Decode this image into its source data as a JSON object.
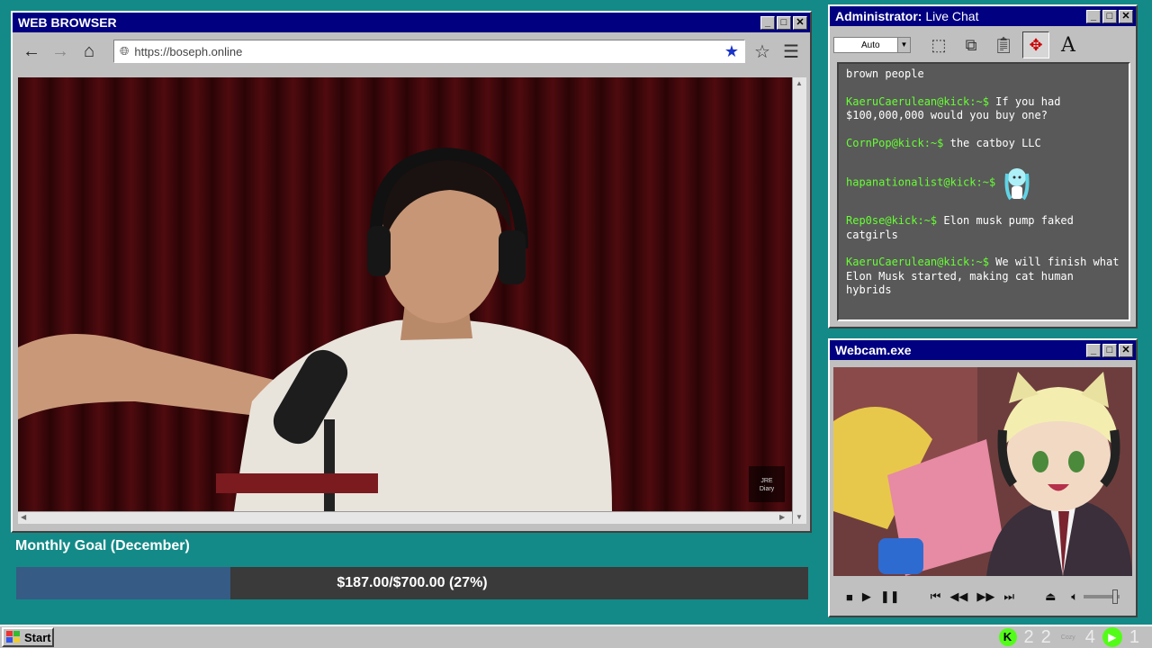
{
  "browser": {
    "title": "WEB BROWSER",
    "url": "https://boseph.online",
    "video_watermark": "JRE\nDiary"
  },
  "chat": {
    "title_prefix": "Administrator:",
    "title": " Live Chat",
    "font_select": "Auto",
    "messages": [
      {
        "user": "",
        "text": "brown people"
      },
      {
        "user": "KaeruCaerulean@kick:~$",
        "text": " If you had $100,000,000 would you buy one?"
      },
      {
        "user": "CornPop@kick:~$",
        "text": " the catboy LLC"
      },
      {
        "user": "hapanationalist@kick:~$",
        "text": ""
      },
      {
        "user": "Rep0se@kick:~$",
        "text": " Elon musk pump faked catgirls"
      },
      {
        "user": "KaeruCaerulean@kick:~$",
        "text": " We will finish what Elon Musk started, making cat human hybrids"
      }
    ]
  },
  "webcam": {
    "title": "Webcam.exe"
  },
  "goal": {
    "label": "Monthly Goal (December)",
    "text": "$187.00/$700.00 (27%)",
    "current": 187,
    "target": 700,
    "fraction": 0.27
  },
  "taskbar": {
    "start_label": "Start",
    "tray": {
      "count_a": "2",
      "count_b": "2",
      "cozy_label": "Cozy",
      "count_c": "4",
      "count_d": "1"
    }
  },
  "colors": {
    "desktop": "#138a87",
    "titlebar": "#000080",
    "kick_green": "#53fc18",
    "goal_fill": "#365b85"
  }
}
